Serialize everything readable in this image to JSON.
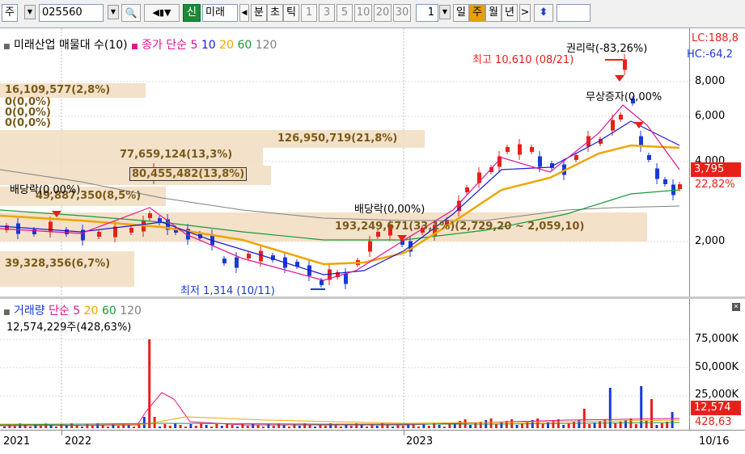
{
  "toolbar": {
    "market_label": "주",
    "code_value": "025560",
    "logo_label": "신",
    "name_value": "미래",
    "period_minute": "분",
    "period_second": "초",
    "period_tick": "틱",
    "intervals": [
      "1",
      "3",
      "5",
      "10",
      "20",
      "30"
    ],
    "interval_value": "1",
    "period_day": "일",
    "period_week": "주",
    "period_month": "월",
    "period_year": "년",
    "arrow_glyph": ">",
    "sort_glyph": "⬍"
  },
  "price_panel": {
    "legend_title": "미래산업 매물대 수(10)",
    "legend_ma_label": "종가 단순",
    "ma_periods": [
      "5",
      "10",
      "20",
      "60",
      "120"
    ],
    "ma_colors": [
      "#e0148c",
      "#1a1ad8",
      "#f0a500",
      "#1a9a3a",
      "#808080"
    ],
    "lc_label": "LC:188,8",
    "hc_label": "HC:-64,2",
    "y_ticks": [
      "8,000",
      "6,000",
      "4,000",
      "2,000"
    ],
    "current_price": "3,795",
    "current_pct": "22,82%",
    "volume_profile": [
      "16,109,577(2,8%)",
      "0(0,0%)",
      "0(0,0%)",
      "0(0,0%)",
      "126,950,719(21,8%)",
      "77,659,124(13,3%)",
      "80,455,482(13,8%)",
      "49,887,350(8,5%)",
      "193,249,671(33,1%)(2,729,20 ~ 2,059,10)",
      "39,328,356(6,7%)"
    ],
    "annotations": {
      "high": "최고 10,610 (08/21)",
      "low": "최저 1,314 (10/11)",
      "rights": "권리락(-83,26%)",
      "bonus": "무상증자(0,00%",
      "dividend_1": "배당락(0,00%)",
      "dividend_2": "배당락(0,00%)"
    }
  },
  "volume_panel": {
    "legend_title": "거래량",
    "legend_ma_label": "단순",
    "ma_periods": [
      "5",
      "20",
      "60",
      "120"
    ],
    "ma_colors": [
      "#e0148c",
      "#f0a500",
      "#1a9a3a",
      "#808080"
    ],
    "peak_label": "12,574,229주(428,63%)",
    "y_ticks": [
      "75,000K",
      "50,000K",
      "25,000K"
    ],
    "current_volume": "12,574",
    "current_pct": "428,63"
  },
  "x_axis": {
    "labels": [
      "2021",
      "2022",
      "2023"
    ],
    "right_date": "10/16"
  },
  "colors": {
    "up": "#e8201a",
    "down": "#1a3ad8",
    "profile_bar": "#f1dcc0",
    "profile_text": "#7a5a1a"
  }
}
